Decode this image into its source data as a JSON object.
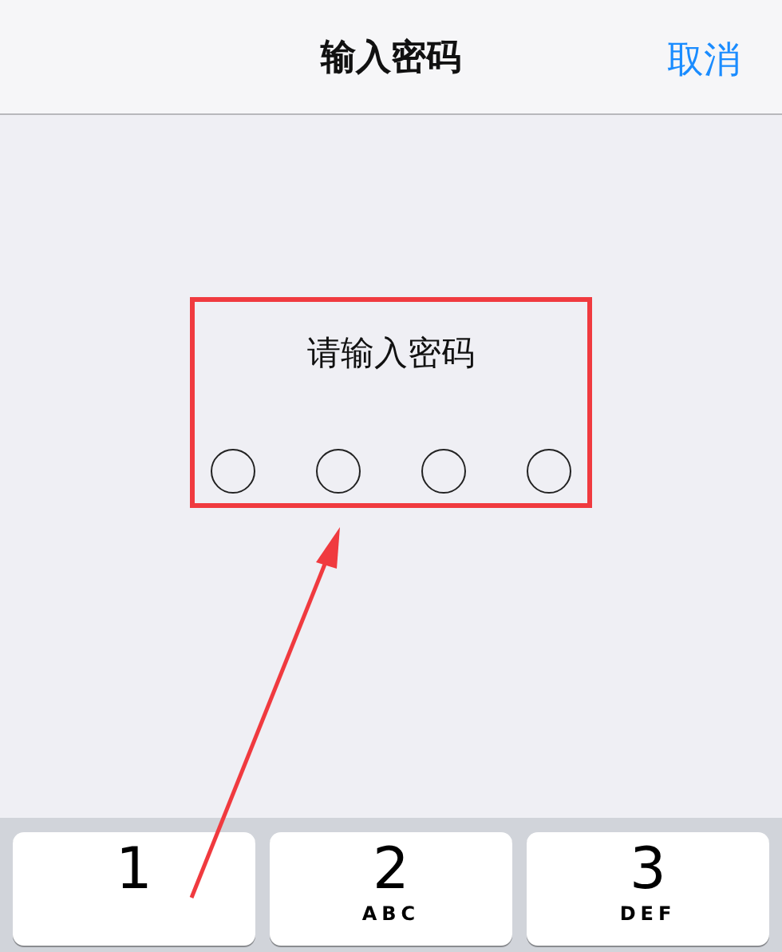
{
  "nav_bar": {
    "title": "输入密码",
    "cancel": "取消"
  },
  "passcode": {
    "prompt": "请输入密码",
    "dots": [
      {
        "filled": false
      },
      {
        "filled": false
      },
      {
        "filled": false
      },
      {
        "filled": false
      }
    ]
  },
  "annotation": {
    "highlight_box": true,
    "arrow": true
  },
  "keypad": [
    {
      "digit": "1"
    },
    {
      "digit": "2",
      "letters": "ABC"
    },
    {
      "digit": "3",
      "letters": "DEF"
    }
  ]
}
